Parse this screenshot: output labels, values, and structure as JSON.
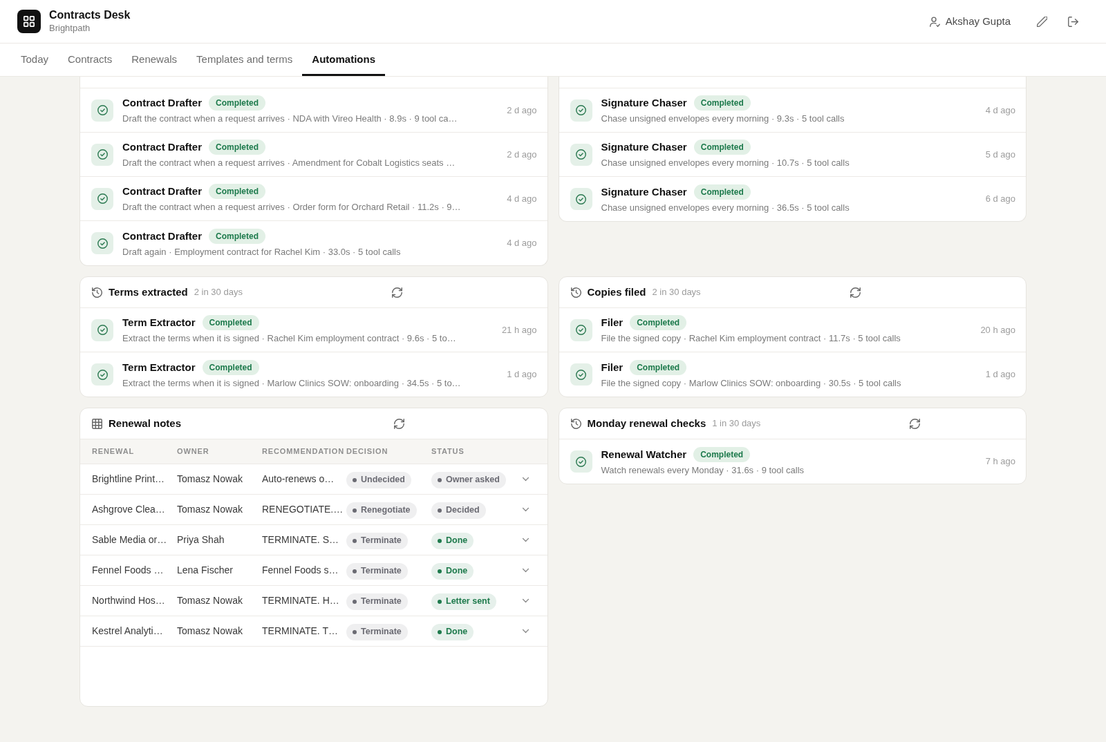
{
  "app": {
    "title": "Contracts Desk",
    "subtitle": "Brightpath"
  },
  "user": {
    "name": "Akshay Gupta"
  },
  "tabs": [
    {
      "label": "Today",
      "selected": false
    },
    {
      "label": "Contracts",
      "selected": false
    },
    {
      "label": "Renewals",
      "selected": false
    },
    {
      "label": "Templates and terms",
      "selected": false
    },
    {
      "label": "Automations",
      "selected": true
    }
  ],
  "sections": [
    {
      "kind": "runs",
      "runs": [
        {
          "agent": "Contract Drafter",
          "status": "Completed",
          "detail": "Draft the contract when a request arrives · NDA with Vireo Health · 8.9s · 9 tool ca…",
          "time": "2 d ago"
        },
        {
          "agent": "Contract Drafter",
          "status": "Completed",
          "detail": "Draft the contract when a request arrives · Amendment for Cobalt Logistics seats …",
          "time": "2 d ago"
        },
        {
          "agent": "Contract Drafter",
          "status": "Completed",
          "detail": "Draft the contract when a request arrives · Order form for Orchard Retail · 11.2s · 9…",
          "time": "4 d ago"
        },
        {
          "agent": "Contract Drafter",
          "status": "Completed",
          "detail": "Draft again · Employment contract for Rachel Kim · 33.0s · 5 tool calls",
          "time": "4 d ago"
        }
      ]
    },
    {
      "kind": "runs",
      "runs": [
        {
          "agent": "Signature Chaser",
          "status": "Completed",
          "detail": "Chase unsigned envelopes every morning · 9.3s · 5 tool calls",
          "time": "4 d ago"
        },
        {
          "agent": "Signature Chaser",
          "status": "Completed",
          "detail": "Chase unsigned envelopes every morning · 10.7s · 5 tool calls",
          "time": "5 d ago"
        },
        {
          "agent": "Signature Chaser",
          "status": "Completed",
          "detail": "Chase unsigned envelopes every morning · 36.5s · 5 tool calls",
          "time": "6 d ago"
        }
      ]
    },
    {
      "kind": "runs",
      "title": "Terms extracted",
      "count": "2 in 30 days",
      "runs": [
        {
          "agent": "Term Extractor",
          "status": "Completed",
          "detail": "Extract the terms when it is signed · Rachel Kim employment contract · 9.6s · 5 to…",
          "time": "21 h ago"
        },
        {
          "agent": "Term Extractor",
          "status": "Completed",
          "detail": "Extract the terms when it is signed · Marlow Clinics SOW: onboarding · 34.5s · 5 to…",
          "time": "1 d ago"
        }
      ]
    },
    {
      "kind": "runs",
      "title": "Copies filed",
      "count": "2 in 30 days",
      "runs": [
        {
          "agent": "Filer",
          "status": "Completed",
          "detail": "File the signed copy · Rachel Kim employment contract · 11.7s · 5 tool calls",
          "time": "20 h ago"
        },
        {
          "agent": "Filer",
          "status": "Completed",
          "detail": "File the signed copy · Marlow Clinics SOW: onboarding · 30.5s · 5 tool calls",
          "time": "1 d ago"
        }
      ]
    },
    {
      "kind": "table",
      "title": "Renewal notes",
      "columns": [
        "RENEWAL",
        "OWNER",
        "RECOMMENDATION",
        "DECISION",
        "STATUS"
      ],
      "rows": [
        {
          "renewal": "Brightline Print…",
          "owner": "Tomasz Nowak",
          "recommendation": "Auto-renews o…",
          "decision": "Undecided",
          "status": {
            "label": "Owner asked",
            "color": "#6b6b73"
          },
          "expanded": false
        },
        {
          "renewal": "Ashgrove Clea…",
          "owner": "Tomasz Nowak",
          "recommendation": "RENEGOTIATE.…",
          "decision": "Renegotiate",
          "status": {
            "label": "Decided",
            "color": "#6b6b73"
          },
          "expanded": false
        },
        {
          "renewal": "Sable Media or…",
          "owner": "Priya Shah",
          "recommendation": "TERMINATE. S…",
          "decision": "Terminate",
          "status": {
            "label": "Done",
            "color": "#1e7a4c"
          },
          "expanded": false
        },
        {
          "renewal": "Fennel Foods …",
          "owner": "Lena Fischer",
          "recommendation": "Fennel Foods s…",
          "decision": "Terminate",
          "status": {
            "label": "Done",
            "color": "#1e7a4c"
          },
          "expanded": false
        },
        {
          "renewal": "Northwind Hos…",
          "owner": "Tomasz Nowak",
          "recommendation": "TERMINATE. H…",
          "decision": "Terminate",
          "status": {
            "label": "Letter sent",
            "color": "#1e7a4c"
          },
          "expanded": false
        },
        {
          "renewal": "Kestrel Analyti…",
          "owner": "Tomasz Nowak",
          "recommendation": "TERMINATE. T…",
          "decision": "Terminate",
          "status": {
            "label": "Done",
            "color": "#1e7a4c"
          },
          "expanded": false
        }
      ]
    },
    {
      "kind": "runs",
      "title": "Monday renewal checks",
      "count": "1 in 30 days",
      "runs": [
        {
          "agent": "Renewal Watcher",
          "status": "Completed",
          "detail": "Watch renewals every Monday · 31.6s · 9 tool calls",
          "time": "7 h ago"
        }
      ]
    }
  ]
}
